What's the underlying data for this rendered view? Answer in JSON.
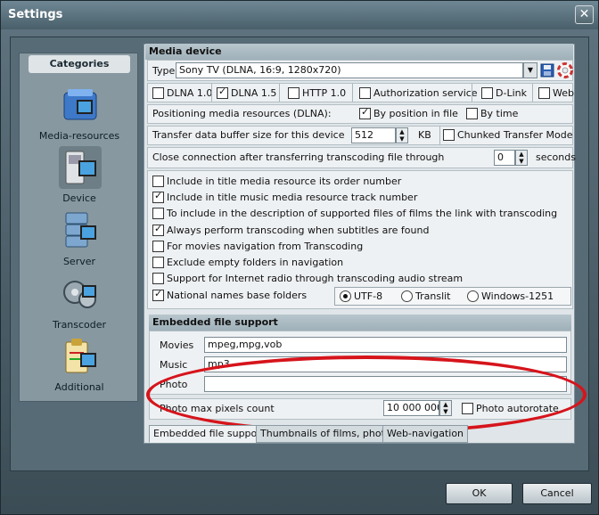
{
  "window": {
    "title": "Settings",
    "close_glyph": "✕"
  },
  "sidebar": {
    "header": "Categories",
    "items": [
      {
        "label": "Media-resources",
        "icon": "media-resources-icon"
      },
      {
        "label": "Device",
        "icon": "device-icon"
      },
      {
        "label": "Server",
        "icon": "server-icon"
      },
      {
        "label": "Transcoder",
        "icon": "transcoder-icon"
      },
      {
        "label": "Additional",
        "icon": "additional-icon"
      }
    ]
  },
  "media_device": {
    "section_title": "Media device",
    "type_label": "Type",
    "type_value": "Sony TV (DLNA, 16:9, 1280x720)",
    "protocols": [
      {
        "label": "DLNA 1.0",
        "checked": false
      },
      {
        "label": "DLNA 1.5",
        "checked": true
      },
      {
        "label": "HTTP 1.0",
        "checked": false
      },
      {
        "label": "Authorization service",
        "checked": false
      },
      {
        "label": "D-Link",
        "checked": false
      },
      {
        "label": "Web",
        "checked": false
      }
    ],
    "positioning_label": "Positioning media resources (DLNA):",
    "by_position_label": "By position in file",
    "by_position_checked": true,
    "by_time_label": "By time",
    "by_time_checked": false,
    "buffer_label": "Transfer data buffer size for this device",
    "buffer_value": "512",
    "buffer_unit": "KB",
    "chunked_label": "Chunked Transfer Mode",
    "chunked_checked": false,
    "close_conn_label": "Close connection after transferring transcoding file through",
    "close_conn_value": "0",
    "close_conn_unit": "seconds"
  },
  "options": [
    {
      "label": "Include in title media resource its order number",
      "checked": false
    },
    {
      "label": "Include in title music media resource track number",
      "checked": true
    },
    {
      "label": "To include in the description of supported files of films the link with transcoding",
      "checked": false
    },
    {
      "label": "Always perform transcoding when subtitles are found",
      "checked": true
    },
    {
      "label": "For movies navigation from Transcoding",
      "checked": false
    },
    {
      "label": "Exclude empty folders in navigation",
      "checked": false
    },
    {
      "label": "Support for Internet radio through transcoding audio stream",
      "checked": false
    },
    {
      "label": "National names base folders",
      "checked": true
    }
  ],
  "encoding": {
    "options": [
      "UTF-8",
      "Translit",
      "Windows-1251"
    ],
    "selected": "UTF-8"
  },
  "embedded": {
    "section_title": "Embedded file support",
    "movies_label": "Movies",
    "movies_value": "mpeg,mpg,vob",
    "music_label": "Music",
    "music_value": "mp3",
    "photo_label": "Photo",
    "photo_value": "",
    "photo_max_label": "Photo max pixels count",
    "photo_max_value": "10 000 000",
    "autorotate_label": "Photo autorotate",
    "autorotate_checked": false
  },
  "tabs": [
    "Embedded file support",
    "Thumbnails of films, photos",
    "Web-navigation"
  ],
  "buttons": {
    "ok": "OK",
    "cancel": "Cancel"
  },
  "colors": {
    "annotation_red": "#d6141b",
    "window_frame": "#4f6470"
  }
}
